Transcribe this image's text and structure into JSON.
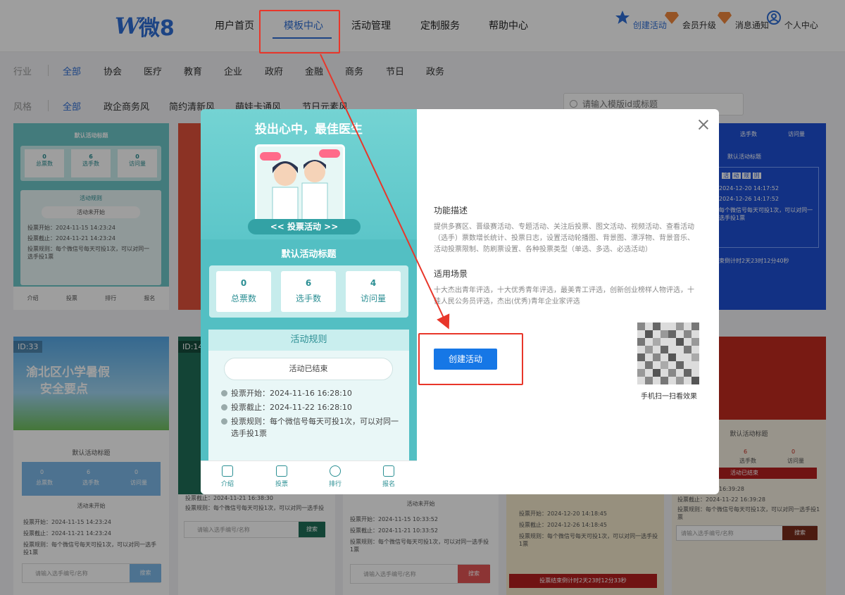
{
  "logo": {
    "letter": "W",
    "text": "微8"
  },
  "nav": {
    "items": [
      "用户首页",
      "模板中心",
      "活动管理",
      "定制服务",
      "帮助中心"
    ],
    "active_index": 1
  },
  "header_actions": [
    "创建活动",
    "会员升级",
    "消息通知",
    "个人中心"
  ],
  "filters": {
    "industry_label": "行业",
    "industries": [
      "全部",
      "协会",
      "医疗",
      "教育",
      "企业",
      "政府",
      "金融",
      "商务",
      "节日",
      "政务"
    ],
    "style_label": "风格",
    "styles": [
      "全部",
      "政企商务风",
      "简约清新风",
      "萌娃卡通风",
      "节日元素风"
    ],
    "search_placeholder": "请输入模版id或标题"
  },
  "background_cards": {
    "c1": {
      "title": "默认活动标题",
      "stats": [
        "0",
        "6",
        "0"
      ],
      "stat_labels": [
        "总票数",
        "选手数",
        "访问量"
      ],
      "rules_title": "活动规则",
      "status": "活动未开始",
      "start": "投票开始：2024-11-15 14:23:24",
      "end": "投票截止：2024-11-21 14:23:24",
      "rule": "投票规则：每个微信号每天可投1次，可以对同一选手投1票",
      "tabs": [
        "介绍",
        "投票",
        "排行",
        "报名"
      ]
    },
    "c2": {
      "id": "ID:33",
      "poster_title": "渝北区小学暑假",
      "poster_sub": "安全要点",
      "title": "默认活动标题",
      "stats": [
        "0",
        "6",
        "0"
      ],
      "stat_labels": [
        "总票数",
        "选手数",
        "访问量"
      ],
      "status": "活动未开始",
      "start": "投票开始：2024-11-15 14:23:24",
      "end": "投票截止：2024-11-21 14:23:24",
      "rule": "投票规则：每个微信号每天可投1次，可以对同一选手投1票",
      "search": "请输入选手编号/名称",
      "search_btn": "搜索"
    },
    "c3": {
      "id": "ID:14",
      "end": "投票截止：2024-11-21 16:38:30",
      "rule": "投票规则：每个微信号每天可投1次，可以对同一选手投",
      "search": "请输入选手编号/名称",
      "search_btn": "搜索"
    },
    "c4": {
      "status": "活动未开始",
      "start": "投票开始：2024-11-15 10:33:52",
      "end": "投票截止：2024-11-21 10:33:52",
      "rule": "投票规则：每个微信号每天可投1次，可以对同一选手投1票",
      "search": "请输入选手编号/名称",
      "search_btn": "搜索"
    },
    "c5": {
      "start": "投票开始：2024-12-20 14:18:45",
      "end": "投票截止：2024-12-26 14:18:45",
      "rule": "投票规则：每个微信号每天可投1次，可以对同一选手投1票",
      "countdown": "投票结束倒计时2天23时12分33秒"
    },
    "c6": {
      "tabs": [
        "选手数",
        "访问量"
      ],
      "title": "默认活动标题",
      "dates": [
        "2024-12-20 14:17:52",
        "2024-12-26 14:17:52"
      ],
      "rule": "每个微信号每天可投1次，可以对同一选手投1票",
      "countdown": "束倒计时2天23时12分40秒",
      "chars": [
        "活",
        "动",
        "规",
        "则"
      ]
    },
    "c7": {
      "title": "默认活动标题",
      "stats": [
        "6",
        "0"
      ],
      "stat_labels": [
        "选手数",
        "访问量"
      ],
      "status": "活动已结束",
      "start": "2024-11-16 16:39:28",
      "end": "投票截止：2024-11-22 16:39:28",
      "rule": "投票规则：每个微信号每天可投1次，可以对同一选手投1票",
      "search": "请输入选手编号/名称",
      "search_btn": "搜索"
    }
  },
  "modal": {
    "preview": {
      "title": "投出心中，最佳医生",
      "vote_banner": "<< 投票活动 >>",
      "activity_title": "默认活动标题",
      "stats": [
        {
          "value": "0",
          "label": "总票数"
        },
        {
          "value": "6",
          "label": "选手数"
        },
        {
          "value": "4",
          "label": "访问量"
        }
      ],
      "rules_title": "活动规则",
      "status": "活动已结束",
      "rules": [
        "投票开始：2024-11-16 16:28:10",
        "投票截止：2024-11-22 16:28:10",
        "投票规则：每个微信号每天可投1次，可以对同一选手投1票"
      ],
      "tabs": [
        "介绍",
        "投票",
        "排行",
        "报名"
      ]
    },
    "desc_title": "功能描述",
    "desc_text": "提供多赛区、晋级赛活动、专题活动、关注后投票、图文活动、视频活动、查看活动（选手）票数增长统计、投票日志，设置活动轮播图、背景图、漂浮物、背景音乐、活动投票限制、防刷票设置、各种投票类型（单选、多选、必选活动）",
    "scene_title": "适用场景",
    "scene_text": "十大杰出青年评选，十大优秀青年评选，最美青工评选，创新创业榜样人物评选，十佳人民公务员评选，杰出(优秀)青年企业家评选",
    "create_button": "创建活动",
    "qr_label": "手机扫一扫看效果"
  },
  "colors": {
    "primary": "#1677e6",
    "accent_red": "#e8362a",
    "teal": "#53bfc3"
  }
}
